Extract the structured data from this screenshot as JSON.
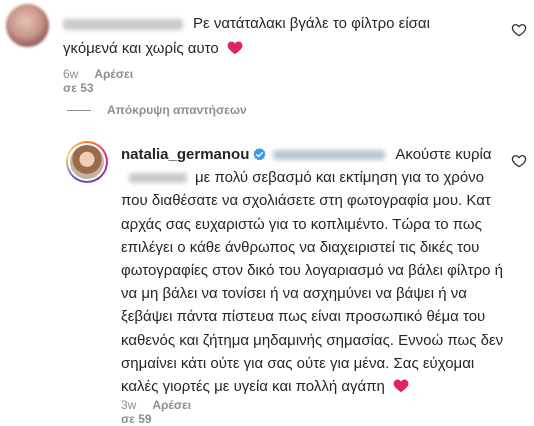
{
  "comment1": {
    "text": "Ρε νατάταλακι βγάλε το φίλτρο είσαι γκόμενά και χωρίς αυτο",
    "time": "6w",
    "likes": "Αρέσει σε 53"
  },
  "replies": {
    "toggle_label": "Απόκρυψη απαντήσεων"
  },
  "reply": {
    "username": "natalia_germanou",
    "text_part1": "Ακούστε κυρία",
    "text_part2": "με πολύ σεβασμό και εκτίμηση για το χρόνο που διαθέσατε να σχολιάσετε στη φωτογραφία μου. Κατ αρχάς σας ευχαριστώ για το κοπλιμέντο. Τώρα το πως επιλέγει ο κάθε άνθρωπος να διαχειριστεί τις δικές του φωτογραφίες στον δικό του λογαριασμό να βάλει φίλτρο ή να μη βάλει να τονίσει ή να ασχημύνει να βάψει ή να ξεβάψει πάντα πίστευα πως είναι προσωπικό θέμα του καθενός και ζήτημα μηδαμινής σημασίας. Εννοώ πως δεν σημαίνει κάτι ούτε για σας ούτε για μένα. Σας εύχομαι καλές γιορτές με υγεία και πολλή αγάπη",
    "time": "3w",
    "likes": "Αρέσει σε 59"
  },
  "colors": {
    "text": "#262626",
    "meta": "#8e8e8e",
    "verified": "#3897f0",
    "heart_emoji": "#e0245e"
  },
  "icons": {
    "like": "heart-outline-icon",
    "verified": "verified-badge-icon",
    "emoji": "red-heart-emoji-icon"
  }
}
